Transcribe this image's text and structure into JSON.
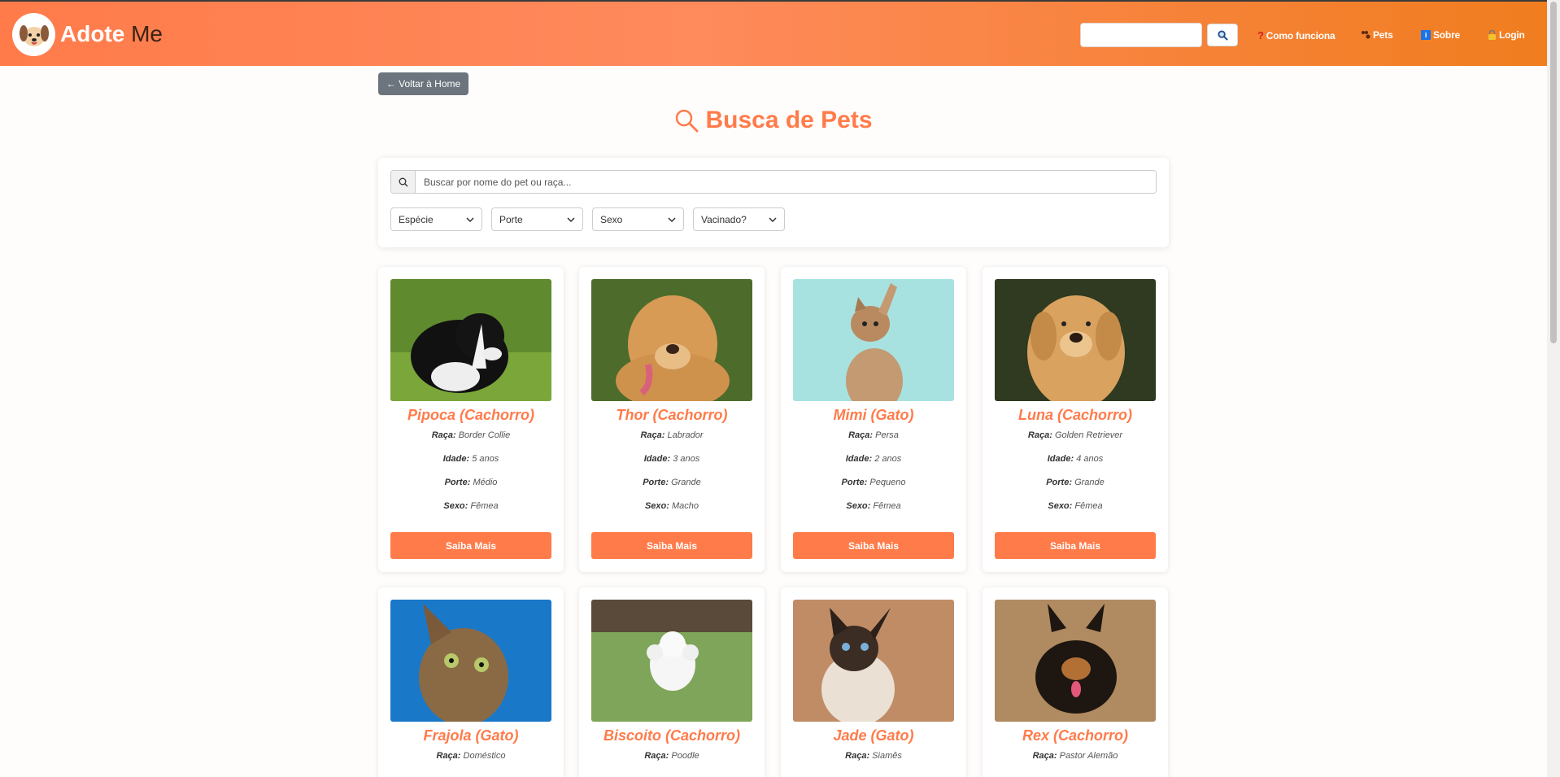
{
  "header": {
    "brand_bold": "Adote",
    "brand_rest": " Me",
    "search_placeholder": "",
    "nav": [
      {
        "label": "Como funciona",
        "icon": "question-icon"
      },
      {
        "label": "Pets",
        "icon": "paw-icon"
      },
      {
        "label": "Sobre",
        "icon": "info-icon"
      },
      {
        "label": "Login",
        "icon": "lock-icon"
      }
    ]
  },
  "back_button": "← Voltar à Home",
  "page_title": "Busca de Pets",
  "filters": {
    "search_placeholder": "Buscar por nome do pet ou raça...",
    "selects": [
      "Espécie",
      "Porte",
      "Sexo",
      "Vacinado?"
    ]
  },
  "labels": {
    "raca": "Raça:",
    "idade": "Idade:",
    "porte": "Porte:",
    "sexo": "Sexo:"
  },
  "cta_label": "Saiba Mais",
  "pets": [
    {
      "name": "Pipoca (Cachorro)",
      "raca": "Border Collie",
      "idade": "5 anos",
      "porte": "Médio",
      "sexo": "Fêmea"
    },
    {
      "name": "Thor (Cachorro)",
      "raca": "Labrador",
      "idade": "3 anos",
      "porte": "Grande",
      "sexo": "Macho"
    },
    {
      "name": "Mimi (Gato)",
      "raca": "Persa",
      "idade": "2 anos",
      "porte": "Pequeno",
      "sexo": "Fêmea"
    },
    {
      "name": "Luna (Cachorro)",
      "raca": "Golden Retriever",
      "idade": "4 anos",
      "porte": "Grande",
      "sexo": "Fêmea"
    },
    {
      "name": "Frajola (Gato)",
      "raca": "Doméstico"
    },
    {
      "name": "Biscoito (Cachorro)",
      "raca": "Poodle"
    },
    {
      "name": "Jade (Gato)",
      "raca": "Siamês"
    },
    {
      "name": "Rex (Cachorro)",
      "raca": "Pastor Alemão"
    }
  ],
  "colors": {
    "accent": "#ff7b4a",
    "header_end": "#f07d1e",
    "back_button": "#6c757d"
  }
}
